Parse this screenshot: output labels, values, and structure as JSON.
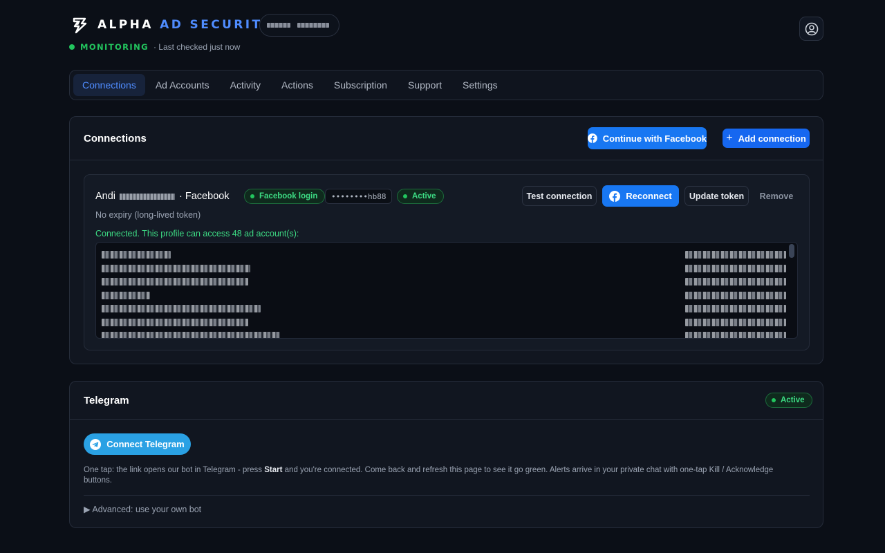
{
  "header": {
    "brand_part1": "ALPHA",
    "brand_part2": "AD SECURITY",
    "status_label": "MONITORING",
    "last_checked": "· Last checked just now"
  },
  "tabs": [
    {
      "label": "Connections",
      "active": true
    },
    {
      "label": "Ad Accounts",
      "active": false
    },
    {
      "label": "Activity",
      "active": false
    },
    {
      "label": "Actions",
      "active": false
    },
    {
      "label": "Subscription",
      "active": false
    },
    {
      "label": "Support",
      "active": false
    },
    {
      "label": "Settings",
      "active": false
    }
  ],
  "connections": {
    "title": "Connections",
    "continue_facebook_label": "Continue with Facebook",
    "add_connection_label": "Add connection",
    "item": {
      "name_first": "Andi",
      "name_suffix": "· Facebook",
      "login_badge": "Facebook login",
      "token_masked": "••••••••hb88",
      "status_badge": "Active",
      "test_label": "Test connection",
      "reconnect_label": "Reconnect",
      "update_label": "Update token",
      "remove_label": "Remove",
      "expiry": "No expiry (long-lived token)",
      "connected_message": "Connected. This profile can access 48 ad account(s):"
    }
  },
  "telegram": {
    "title": "Telegram",
    "status_badge": "Active",
    "connect_label": "Connect Telegram",
    "desc_part1": "One tap: the link opens our bot in Telegram - press ",
    "desc_bold": "Start",
    "desc_part2": " and you're connected. Come back and refresh this page to see it go green. Alerts arrive in your private chat with one-tap Kill / Acknowledge buttons.",
    "advanced_label": "▶ Advanced: use your own bot"
  },
  "colors": {
    "background": "#0b0f17",
    "accent": "#4f8cff",
    "success": "#22c55e",
    "facebook": "#1877f2",
    "telegram": "#2aa1e4"
  }
}
